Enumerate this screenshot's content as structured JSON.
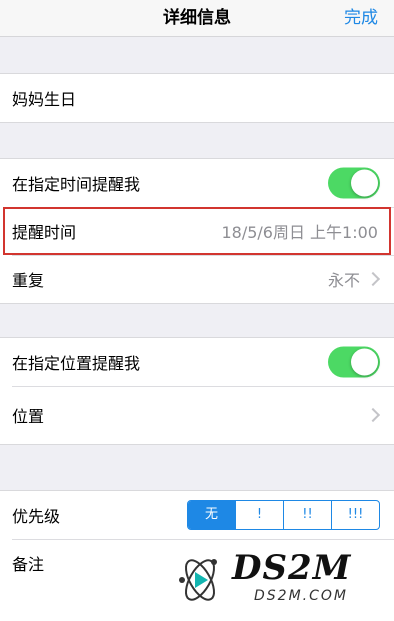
{
  "nav": {
    "title": "详细信息",
    "done": "完成"
  },
  "reminder_title": "妈妈生日",
  "time_section": {
    "remind_at_time_label": "在指定时间提醒我",
    "alarm_label": "提醒时间",
    "alarm_value": "18/5/6周日 上午1:00",
    "repeat_label": "重复",
    "repeat_value": "永不"
  },
  "location_section": {
    "remind_at_location_label": "在指定位置提醒我",
    "location_label": "位置"
  },
  "priority": {
    "label": "优先级",
    "options": [
      "无",
      "!",
      "!!",
      "!!!"
    ],
    "selected": "无"
  },
  "notes_label": "备注",
  "watermark": {
    "logo_text": "DS2M",
    "url_text": "DS2M.COM"
  },
  "colors": {
    "accent": "#1e88e5",
    "toggle_on": "#4cd964",
    "highlight_box": "#d2352f"
  }
}
